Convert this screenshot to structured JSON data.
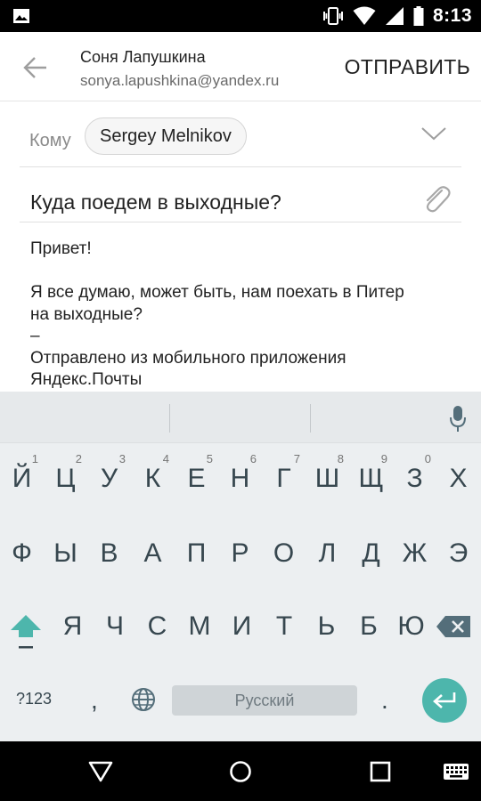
{
  "status_bar": {
    "time": "8:13",
    "icons": [
      "image-icon",
      "vibrate-icon",
      "wifi-icon",
      "signal-icon",
      "battery-icon"
    ]
  },
  "header": {
    "sender_name": "Соня Лапушкина",
    "sender_email": "sonya.lapushkina@yandex.ru",
    "send_label": "ОТПРАВИТЬ"
  },
  "recipient": {
    "label": "Кому",
    "chip": "Sergey Melnikov"
  },
  "subject": "Куда поедем в выходные?",
  "body": {
    "lines": [
      "Привет!",
      "",
      "Я все думаю, может быть, нам поехать в Питер",
      "на выходные?",
      "–",
      "Отправлено из мобильного приложения",
      "Яндекс.Почты"
    ]
  },
  "keyboard": {
    "row1": [
      {
        "label": "Й",
        "hint": "1"
      },
      {
        "label": "Ц",
        "hint": "2"
      },
      {
        "label": "У",
        "hint": "3"
      },
      {
        "label": "К",
        "hint": "4"
      },
      {
        "label": "Е",
        "hint": "5"
      },
      {
        "label": "Н",
        "hint": "6"
      },
      {
        "label": "Г",
        "hint": "7"
      },
      {
        "label": "Ш",
        "hint": "8"
      },
      {
        "label": "Щ",
        "hint": "9"
      },
      {
        "label": "З",
        "hint": "0"
      },
      {
        "label": "Х",
        "hint": ""
      }
    ],
    "row2": [
      "Ф",
      "Ы",
      "В",
      "А",
      "П",
      "Р",
      "О",
      "Л",
      "Д",
      "Ж",
      "Э"
    ],
    "row3": [
      "Я",
      "Ч",
      "С",
      "М",
      "И",
      "Т",
      "Ь",
      "Б",
      "Ю"
    ],
    "symbols_key": "?123",
    "comma_key": ",",
    "space_label": "Русский",
    "period_key": ".",
    "accent_color": "#4db6ac"
  },
  "nav_bar": {
    "icons": [
      "back-triangle-icon",
      "home-circle-icon",
      "recents-square-icon",
      "keyboard-icon"
    ]
  }
}
